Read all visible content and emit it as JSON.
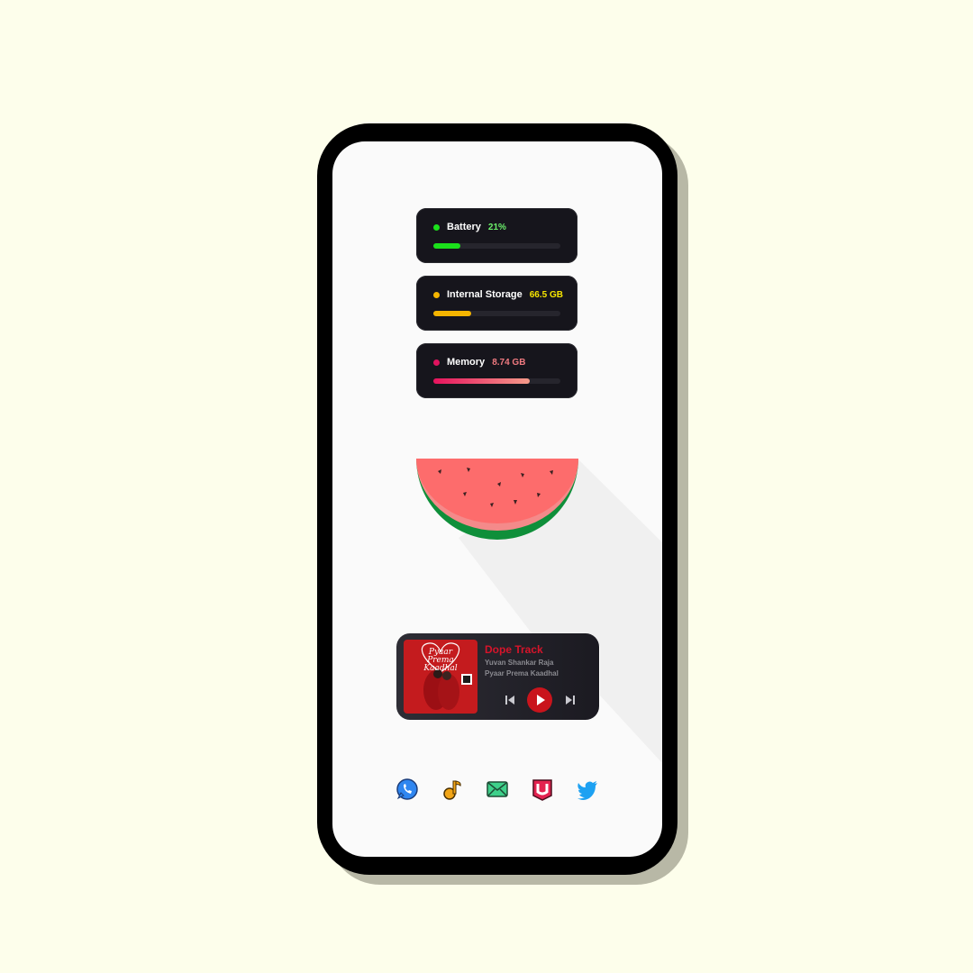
{
  "stats": [
    {
      "label": "Battery",
      "value": "21%",
      "fraction": 0.21,
      "dot_color": "#1be01b",
      "value_color": "#6bf06b"
    },
    {
      "label": "Internal Storage",
      "value": "66.5 GB",
      "fraction": 0.3,
      "dot_color": "#f5b500",
      "value_color": "#f6e500"
    },
    {
      "label": "Memory",
      "value": "8.74 GB",
      "fraction": 0.76,
      "dot_color": "#e0135e",
      "value_color": "#f07a80"
    }
  ],
  "watermelon": {
    "flesh_color": "#fd6c6c",
    "rind_color": "#0f8f3a"
  },
  "player": {
    "album_art_title": "Pyaar Prema Kaadhal",
    "track_title": "Dope Track",
    "artist": "Yuvan Shankar Raja",
    "album": "Pyaar Prema Kaadhal",
    "accent_color": "#d6142a"
  },
  "dock": [
    {
      "name": "phone-app-icon",
      "color": "#2f86f0"
    },
    {
      "name": "music-app-icon",
      "color": "#f2a516"
    },
    {
      "name": "mail-app-icon",
      "color": "#3ed08a"
    },
    {
      "name": "u-app-icon",
      "color": "#e3224f"
    },
    {
      "name": "twitter-icon",
      "color": "#1da1f2"
    }
  ]
}
